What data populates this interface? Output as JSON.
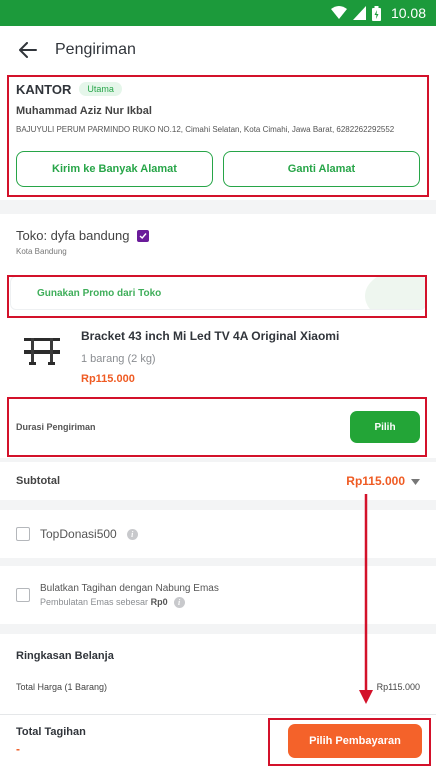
{
  "status_bar": {
    "time": "10.08"
  },
  "app_bar": {
    "title": "Pengiriman"
  },
  "address": {
    "label": "KANTOR",
    "badge": "Utama",
    "name": "Muhammad Aziz Nur Ikbal",
    "detail": "BAJUYULI PERUM PARMINDO RUKO NO.12, Cimahi Selatan, Kota Cimahi, Jawa Barat, 6282262292552",
    "button_multi": "Kirim ke Banyak Alamat",
    "button_change": "Ganti Alamat"
  },
  "shop": {
    "name": "Toko: dyfa bandung",
    "city": "Kota Bandung"
  },
  "promo": {
    "label": "Gunakan Promo dari Toko"
  },
  "product": {
    "name": "Bracket 43 inch Mi Led TV 4A Original Xiaomi",
    "quantity": "1 barang (2 kg)",
    "price": "Rp115.000"
  },
  "shipping": {
    "label": "Durasi Pengiriman",
    "button": "Pilih"
  },
  "subtotal": {
    "label": "Subtotal",
    "value": "Rp115.000"
  },
  "donation": {
    "label": "TopDonasi500"
  },
  "gold": {
    "title": "Bulatkan Tagihan dengan Nabung Emas",
    "sub_prefix": "Pembulatan Emas sebesar",
    "sub_amount": "Rp0"
  },
  "summary": {
    "title": "Ringkasan Belanja",
    "total_label": "Total Harga (1 Barang)",
    "total_value": "Rp115.000"
  },
  "bottom": {
    "label": "Total Tagihan",
    "value": "-",
    "pay_button": "Pilih Pembayaran"
  },
  "colors": {
    "primary_green": "#23a537",
    "status_green": "#1c9a3b",
    "accent_orange": "#ef5b23",
    "annotation_red": "#d3112a"
  }
}
